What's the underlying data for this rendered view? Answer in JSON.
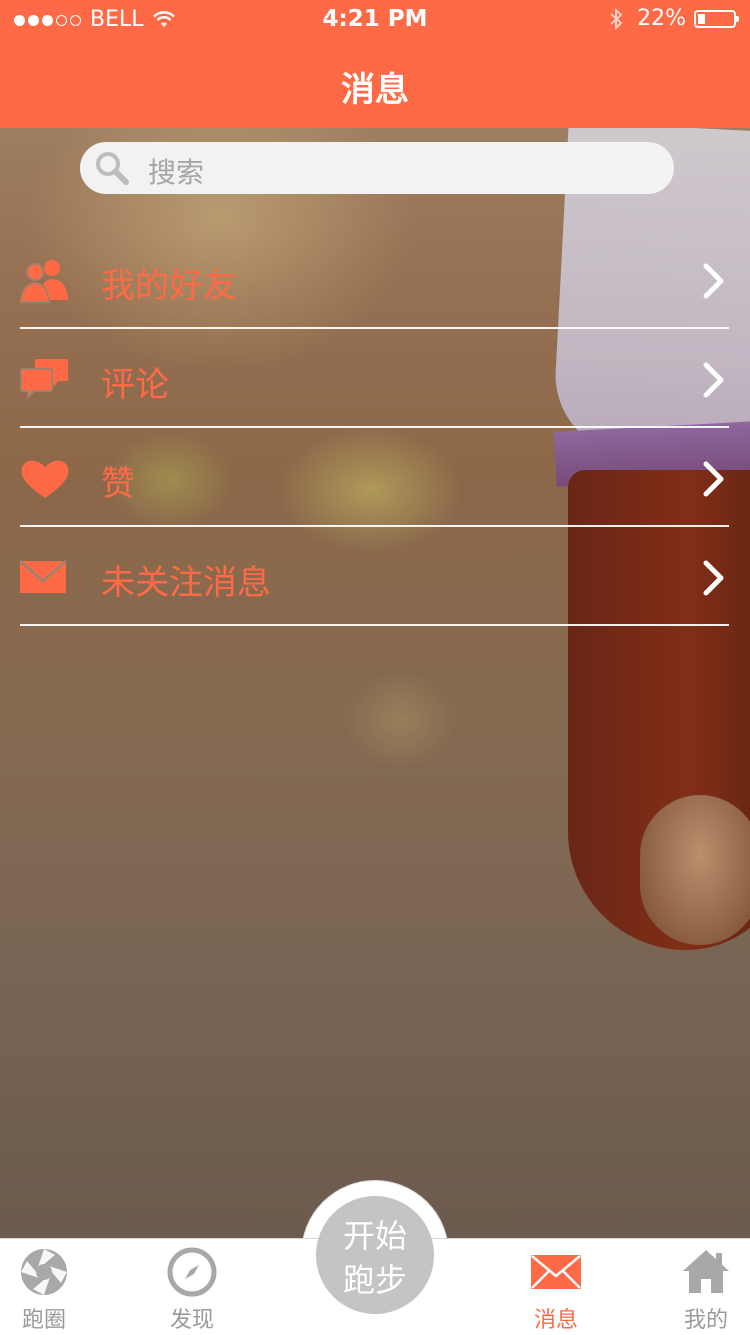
{
  "status_bar": {
    "carrier": "BELL",
    "time": "4:21 PM",
    "battery": "22%",
    "battery_level": 0.22
  },
  "header": {
    "title": "消息"
  },
  "search": {
    "placeholder": "搜索"
  },
  "menu": {
    "items": [
      {
        "label": "我的好友",
        "icon": "friends-icon"
      },
      {
        "label": "评论",
        "icon": "comments-icon"
      },
      {
        "label": "赞",
        "icon": "heart-icon"
      },
      {
        "label": "未关注消息",
        "icon": "mail-icon"
      }
    ]
  },
  "tabbar": {
    "tabs": [
      {
        "label": "跑圈",
        "icon": "aperture-icon",
        "active": false
      },
      {
        "label": "发现",
        "icon": "compass-icon",
        "active": false
      },
      {
        "label": "消息",
        "icon": "mail-icon",
        "active": true
      },
      {
        "label": "我的",
        "icon": "home-icon",
        "active": false
      }
    ],
    "start_button": {
      "line1": "开始",
      "line2": "跑步"
    }
  },
  "colors": {
    "accent": "#ff6a46",
    "tab_inactive": "#9a9a9a",
    "start_button": "#c4c4c4"
  }
}
